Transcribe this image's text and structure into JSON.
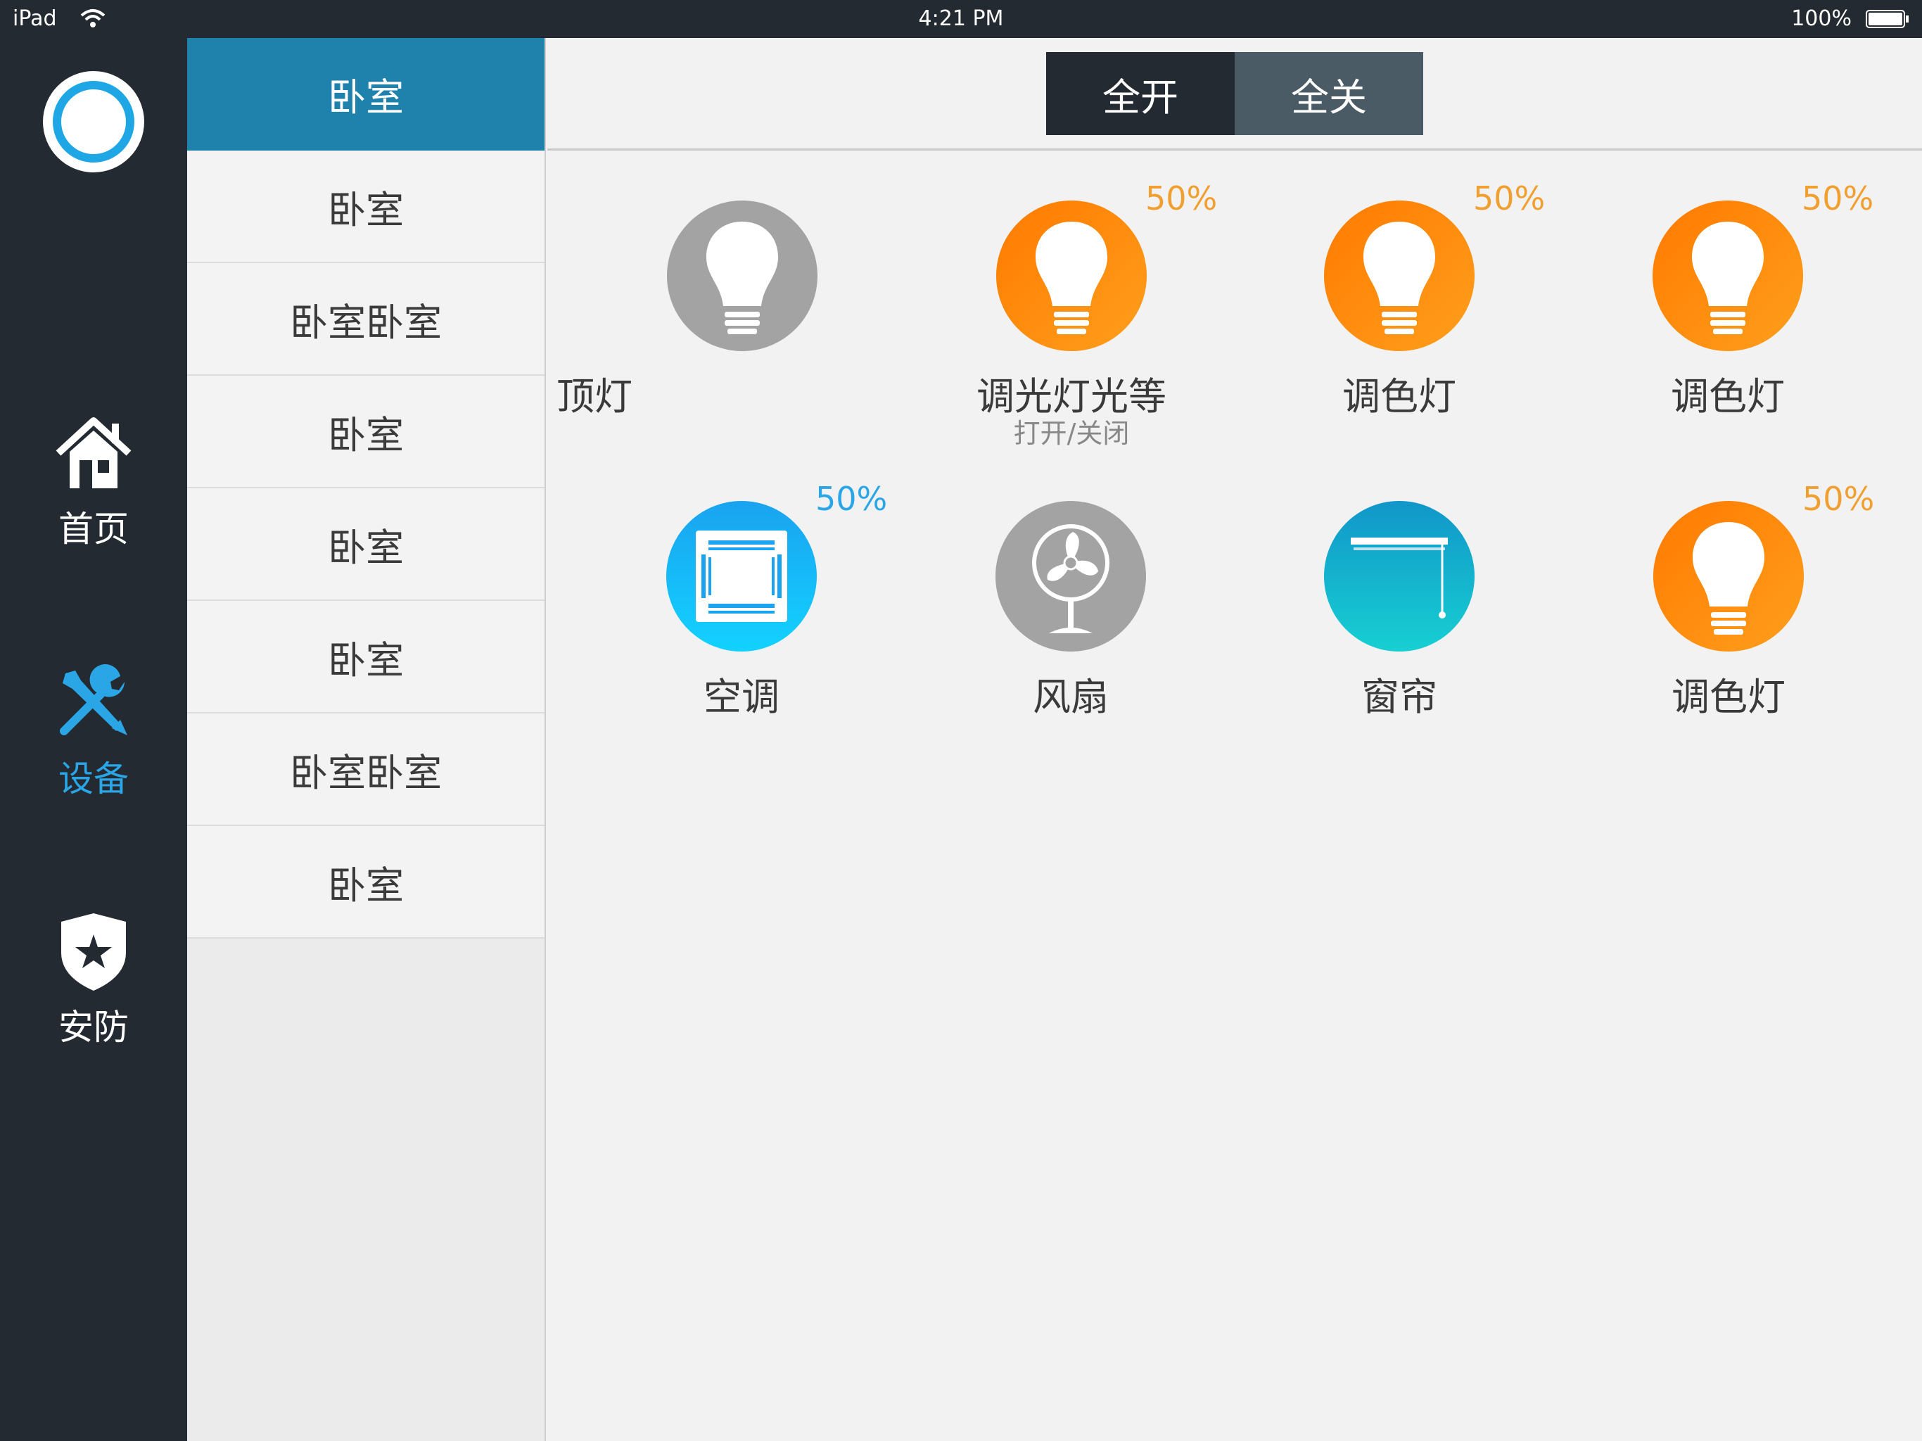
{
  "status_bar": {
    "carrier": "iPad",
    "time": "4:21 PM",
    "battery": "100%"
  },
  "nav": {
    "items": [
      {
        "label": "首页",
        "icon": "home-icon"
      },
      {
        "label": "设备",
        "icon": "tools-icon",
        "active": true
      },
      {
        "label": "安防",
        "icon": "shield-star-icon"
      }
    ]
  },
  "rooms": [
    {
      "label": "卧室",
      "selected": true
    },
    {
      "label": "卧室"
    },
    {
      "label": "卧室卧室"
    },
    {
      "label": "卧室"
    },
    {
      "label": "卧室"
    },
    {
      "label": "卧室"
    },
    {
      "label": "卧室卧室"
    },
    {
      "label": "卧室"
    }
  ],
  "header": {
    "all_on": "全开",
    "all_off": "全关"
  },
  "devices": [
    {
      "name": "顶灯",
      "percent": "",
      "icon": "bulb-icon",
      "state": "off"
    },
    {
      "name": "调光灯光等",
      "percent": "50%",
      "subtitle": "打开/关闭",
      "icon": "bulb-icon",
      "state": "on"
    },
    {
      "name": "调色灯",
      "percent": "50%",
      "icon": "bulb-icon",
      "state": "on"
    },
    {
      "name": "调色灯",
      "percent": "50%",
      "icon": "bulb-icon",
      "state": "on"
    },
    {
      "name": "空调",
      "percent": "50%",
      "icon": "air-conditioner-icon",
      "state": "on"
    },
    {
      "name": "风扇",
      "percent": "",
      "icon": "fan-icon",
      "state": "off"
    },
    {
      "name": "窗帘",
      "percent": "",
      "icon": "curtain-icon",
      "state": "on"
    },
    {
      "name": "调色灯",
      "percent": "50%",
      "icon": "bulb-icon",
      "state": "on"
    }
  ],
  "colors": {
    "rail_bg": "#242a31",
    "selected_room": "#1f82ad",
    "active_nav": "#2aa6e6",
    "light_on": "#ff8a00",
    "light_pct": "#f0a030",
    "ac_pct": "#2aa6e6"
  }
}
